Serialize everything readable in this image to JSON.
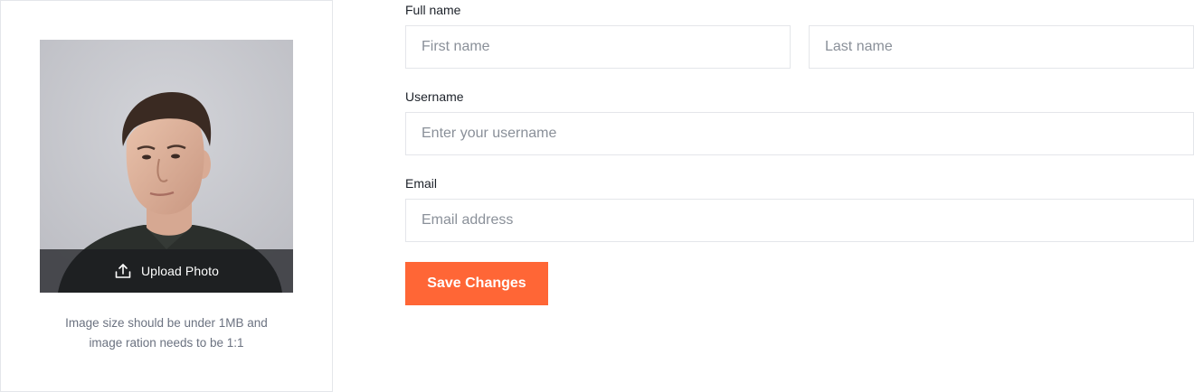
{
  "photo": {
    "upload_label": "Upload Photo",
    "hint_line1": "Image size should be under 1MB and",
    "hint_line2": "image ration needs to be 1:1"
  },
  "form": {
    "full_name_label": "Full name",
    "first_name_placeholder": "First name",
    "last_name_placeholder": "Last name",
    "username_label": "Username",
    "username_placeholder": "Enter your username",
    "email_label": "Email",
    "email_placeholder": "Email address",
    "save_label": "Save Changes"
  },
  "colors": {
    "accent": "#ff6636",
    "border": "#e4e6ea",
    "placeholder": "#8a9099",
    "hint": "#6b7280"
  },
  "icons": {
    "upload": "upload-icon"
  }
}
